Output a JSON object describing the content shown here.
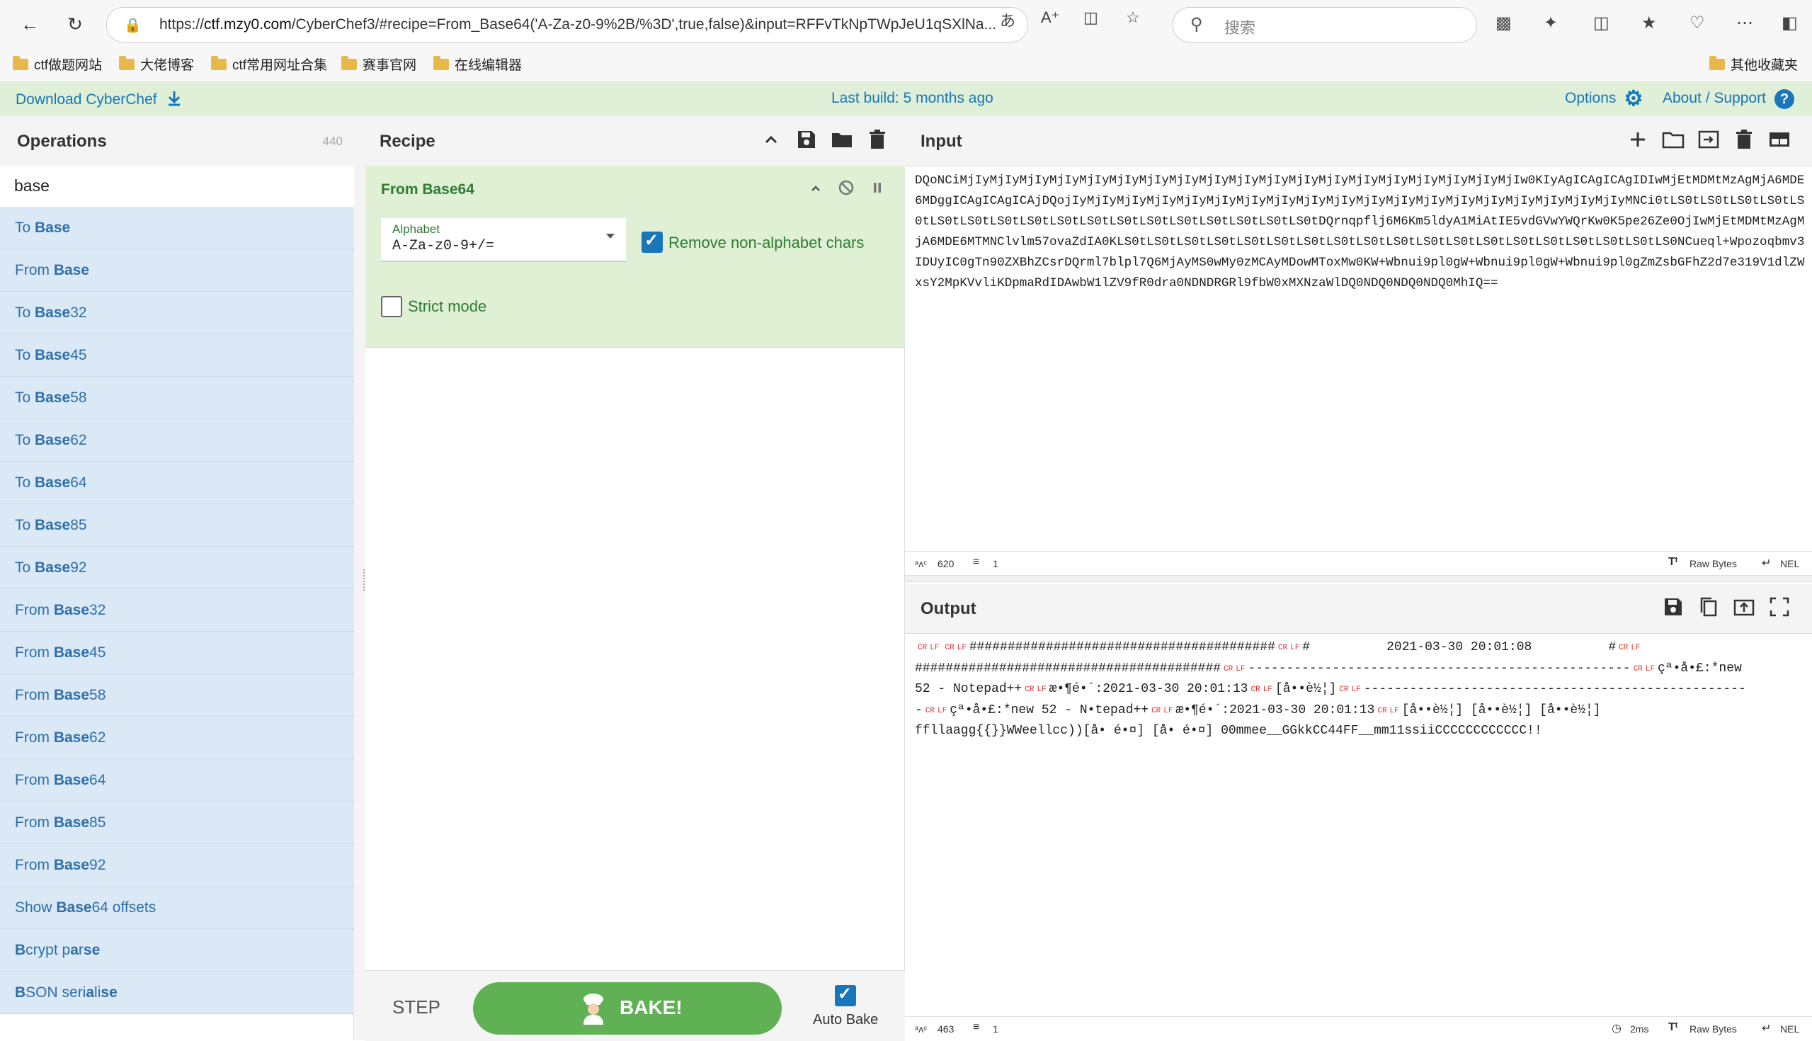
{
  "browser": {
    "url_prefix": "https://",
    "url_host": "ctf.mzy0.com",
    "url_rest": "/CyberChef3/#recipe=From_Base64('A-Za-z0-9%2B/%3D',true,false)&input=RFFvTkNpTWpJeU1qSXlNa...",
    "search_placeholder": "搜索"
  },
  "bookmarks": [
    "ctf做题网站",
    "大佬博客",
    "ctf常用网址合集",
    "赛事官网",
    "在线编辑器"
  ],
  "other_bookmarks": "其他收藏夹",
  "banner": {
    "download": "Download CyberChef",
    "build": "Last build: 5 months ago",
    "options": "Options",
    "about": "About / Support"
  },
  "operations": {
    "title": "Operations",
    "count": "440",
    "search": "base",
    "items": [
      {
        "pre": "To ",
        "hl": "Base",
        "post": ""
      },
      {
        "pre": "From ",
        "hl": "Base",
        "post": ""
      },
      {
        "pre": "To ",
        "hl": "Base",
        "post": "32"
      },
      {
        "pre": "To ",
        "hl": "Base",
        "post": "45"
      },
      {
        "pre": "To ",
        "hl": "Base",
        "post": "58"
      },
      {
        "pre": "To ",
        "hl": "Base",
        "post": "62"
      },
      {
        "pre": "To ",
        "hl": "Base",
        "post": "64"
      },
      {
        "pre": "To ",
        "hl": "Base",
        "post": "85"
      },
      {
        "pre": "To ",
        "hl": "Base",
        "post": "92"
      },
      {
        "pre": "From ",
        "hl": "Base",
        "post": "32"
      },
      {
        "pre": "From ",
        "hl": "Base",
        "post": "45"
      },
      {
        "pre": "From ",
        "hl": "Base",
        "post": "58"
      },
      {
        "pre": "From ",
        "hl": "Base",
        "post": "62"
      },
      {
        "pre": "From ",
        "hl": "Base",
        "post": "64"
      },
      {
        "pre": "From ",
        "hl": "Base",
        "post": "85"
      },
      {
        "pre": "From ",
        "hl": "Base",
        "post": "92"
      },
      {
        "pre": "Show ",
        "hl": "Base",
        "post": "64 offsets"
      },
      {
        "pre": "",
        "hl": "B",
        "post": "crypt p",
        "hl2": "a",
        "post2": "r",
        "hl3": "se",
        "post3": ""
      },
      {
        "pre": "",
        "hl": "B",
        "post": "SON seri",
        "hl2": "a",
        "post2": "li",
        "hl3": "se",
        "post3": ""
      }
    ]
  },
  "recipe": {
    "title": "Recipe",
    "step": {
      "name": "From Base64",
      "alphabet_label": "Alphabet",
      "alphabet_value": "A-Za-z0-9+/=",
      "remove_label": "Remove non-alphabet chars",
      "remove_checked": true,
      "strict_label": "Strict mode",
      "strict_checked": false
    },
    "step_button": "STEP",
    "bake_button": "BAKE!",
    "autobake_label": "Auto Bake",
    "autobake_checked": true
  },
  "input": {
    "title": "Input",
    "text": "DQoNCiMjIyMjIyMjIyMjIyMjIyMjIyMjIyMjIyMjIyMjIyMjIyMjIyMjIyMjIyMjIyMjIyMjIyMjIyMjIw0KIyAgICAgICAgIDIwMjEtMDMtMzAgMjA6MDE6MDggICAgICAgICAjDQojIyMjIyMjIyMjIyMjIyMjIyMjIyMjIyMjIyMjIyMjIyMjIyMjIyMjIyMjIyMjIyMjIyMjIyMjIyMNCi0tLS0tLS0tLS0tLS0tLS0tLS0tLS0tLS0tLS0tLS0tLS0tLS0tLS0tLS0tLS0tLS0tLS0tLS0tDQrnqpflj6M6Km5ldyA1MiAtIE5vdGVwYWQrKw0K5pe26Ze0OjIwMjEtMDMtMzAgMjA6MDE6MTMNClvlm57ovaZdIA0KLS0tLS0tLS0tLS0tLS0tLS0tLS0tLS0tLS0tLS0tLS0tLS0tLS0tLS0tLS0tLS0tLS0tLS0tLS0NCueql+Wpozoqbmv3IDUyIC0gTn90ZXBhZCsrDQrml7blpl7Q6MjAyMS0wMy0zMCAyMDowMToxMw0KW+Wbnui9pl0gW+Wbnui9pl0gW+Wbnui9pl0gZmZsbGFhZ2d7e319V1dlZWxsY2MpKVvliKDpmaRdIDAwbW1lZV9fR0dra0NDNDRGRl9fbW0xMXNzaWlDQ0NDQ0NDQ0NDQ0MhIQ==",
    "length": "620",
    "lines": "1",
    "encoding": "Raw Bytes",
    "eol": "NEL"
  },
  "output": {
    "title": "Output",
    "line1_hash": "########################################",
    "line1_mid": "#          2021-03-30 20:01:08          #",
    "line2_hash": "########################################",
    "line2_dash": "--------------------------------------------------",
    "line2_tail": "çª•å•£:*new",
    "line3_a": "52 - Notepad++",
    "line3_b": "æ•¶é•´:2021-03-30 20:01:13",
    "line3_c": "[å••è½¦]",
    "line3_dash": "--------------------------------------------------",
    "line4_dash": "-",
    "line4_a": "çª•å•£:*new 52 - N•tepad++",
    "line4_b": "æ•¶é•´:2021-03-30 20:01:13",
    "line4_c": "[å••è½¦] [å••è½¦] [å••è½¦]",
    "line5": "ffllaagg{{}}WWeellcc))[å• é•¤] [å• é•¤] 00mmee__GGkkCC44FF__mm11ssiiCCCCCCCCCCCC!!",
    "cr": "CR",
    "lf": "LF",
    "length": "463",
    "lines": "1",
    "time": "2ms",
    "encoding": "Raw Bytes",
    "eol": "NEL"
  }
}
